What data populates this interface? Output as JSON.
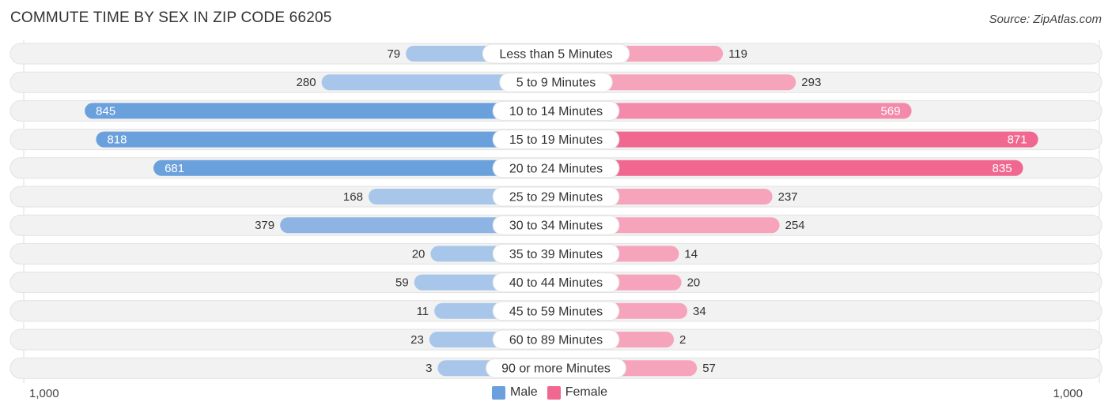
{
  "title": "COMMUTE TIME BY SEX IN ZIP CODE 66205",
  "source": "Source: ZipAtlas.com",
  "legend": {
    "male": "Male",
    "female": "Female"
  },
  "axis": {
    "left": "1,000",
    "right": "1,000"
  },
  "colors": {
    "male_strong": "#6aa0dc",
    "male_light": "#a7c6e9",
    "female_strong": "#f0688f",
    "female_light": "#f6a3bc",
    "row_bg": "#f2f2f2"
  },
  "chart_data": {
    "type": "bar",
    "orientation": "horizontal-diverging",
    "title": "COMMUTE TIME BY SEX IN ZIP CODE 66205",
    "categories": [
      "Less than 5 Minutes",
      "5 to 9 Minutes",
      "10 to 14 Minutes",
      "15 to 19 Minutes",
      "20 to 24 Minutes",
      "25 to 29 Minutes",
      "30 to 34 Minutes",
      "35 to 39 Minutes",
      "40 to 44 Minutes",
      "45 to 59 Minutes",
      "60 to 89 Minutes",
      "90 or more Minutes"
    ],
    "series": [
      {
        "name": "Male",
        "values": [
          79,
          280,
          845,
          818,
          681,
          168,
          379,
          20,
          59,
          11,
          23,
          3
        ]
      },
      {
        "name": "Female",
        "values": [
          119,
          293,
          569,
          871,
          835,
          237,
          254,
          14,
          20,
          34,
          2,
          57
        ]
      }
    ],
    "xlim": [
      -1000,
      1000
    ],
    "tick_labels": [
      "1,000",
      "1,000"
    ],
    "legend_position": "bottom-center"
  }
}
